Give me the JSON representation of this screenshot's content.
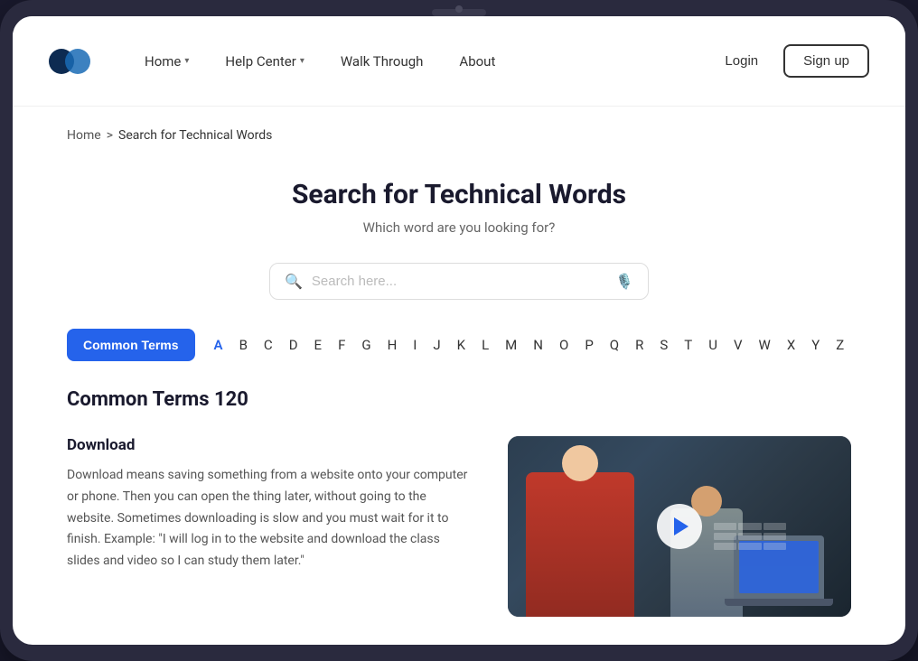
{
  "meta": {
    "title": "Search for Technical Words"
  },
  "navbar": {
    "logo_alt": "Logo",
    "nav_items": [
      {
        "label": "Home",
        "has_dropdown": true
      },
      {
        "label": "Help Center",
        "has_dropdown": true
      },
      {
        "label": "Walk Through",
        "has_dropdown": false
      },
      {
        "label": "About",
        "has_dropdown": false
      }
    ],
    "login_label": "Login",
    "signup_label": "Sign up"
  },
  "breadcrumb": {
    "home": "Home",
    "separator": ">",
    "current": "Search for Technical Words"
  },
  "title_section": {
    "title": "Search for Technical Words",
    "subtitle": "Which word are you looking for?"
  },
  "search": {
    "placeholder": "Search here..."
  },
  "filter": {
    "common_terms_label": "Common Terms",
    "alphabet": [
      "A",
      "B",
      "C",
      "D",
      "E",
      "F",
      "G",
      "H",
      "I",
      "J",
      "K",
      "L",
      "M",
      "N",
      "O",
      "P",
      "Q",
      "R",
      "S",
      "T",
      "U",
      "V",
      "W",
      "X",
      "Y",
      "Z"
    ]
  },
  "section": {
    "title": "Common Terms 120"
  },
  "term": {
    "name": "Download",
    "description": "Download means saving something from a website onto your computer or phone. Then you can open the thing later, without going to the website. Sometimes downloading is slow and you must wait for it to finish. Example: \"I will log in to the website and download the class slides and video so I can study them later.\""
  },
  "video": {
    "play_button_label": "Play"
  }
}
